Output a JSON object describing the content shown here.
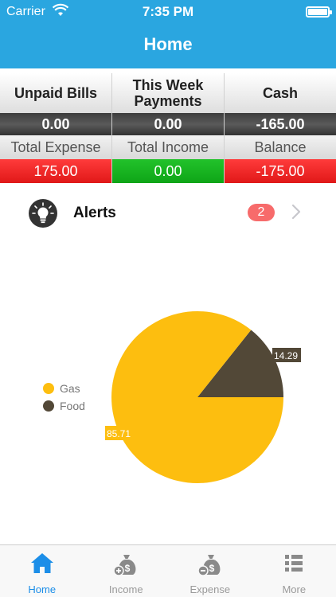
{
  "status_bar": {
    "carrier": "Carrier",
    "time": "7:35 PM"
  },
  "nav": {
    "title": "Home"
  },
  "summary": {
    "headers": [
      "Unpaid Bills",
      "This Week Payments",
      "Cash"
    ],
    "values": [
      "0.00",
      "0.00",
      "-165.00"
    ],
    "sub_headers": [
      "Total Expense",
      "Total Income",
      "Balance"
    ],
    "sub_values": [
      "175.00",
      "0.00",
      "-175.00"
    ],
    "colors": {
      "red": "#e92020",
      "green": "#16b21f",
      "dark": "#444444"
    }
  },
  "alerts": {
    "label": "Alerts",
    "count": "2"
  },
  "chart_data": {
    "type": "pie",
    "title": "",
    "categories": [
      "Gas",
      "Food"
    ],
    "values": [
      85.71,
      14.29
    ],
    "data_labels": [
      "85.71",
      "14.29"
    ],
    "colors": [
      "#fdbe0f",
      "#524837"
    ],
    "legend_position": "left"
  },
  "tabs": [
    {
      "label": "Home",
      "icon": "home-icon",
      "active": true
    },
    {
      "label": "Income",
      "icon": "money-bag-plus-icon",
      "active": false
    },
    {
      "label": "Expense",
      "icon": "money-bag-minus-icon",
      "active": false
    },
    {
      "label": "More",
      "icon": "list-icon",
      "active": false
    }
  ],
  "accent": "#2aa6e0"
}
